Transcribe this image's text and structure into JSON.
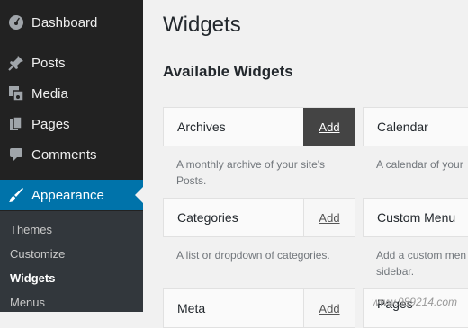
{
  "sidebar": {
    "items": [
      {
        "label": "Dashboard",
        "icon": "dashboard-icon"
      },
      {
        "label": "Posts",
        "icon": "pin-icon"
      },
      {
        "label": "Media",
        "icon": "media-icon"
      },
      {
        "label": "Pages",
        "icon": "pages-icon"
      },
      {
        "label": "Comments",
        "icon": "comment-icon"
      },
      {
        "label": "Appearance",
        "icon": "paintbrush-icon",
        "active": true
      }
    ],
    "submenu": [
      "Themes",
      "Customize",
      "Widgets",
      "Menus"
    ],
    "submenu_current": "Widgets"
  },
  "main": {
    "title": "Widgets",
    "section_title": "Available Widgets",
    "widgets": [
      {
        "name": "Archives",
        "add_label": "Add",
        "description": "A monthly archive of your site's Posts."
      },
      {
        "name": "Calendar",
        "description": "A calendar of your"
      },
      {
        "name": "Categories",
        "add_label": "Add",
        "description": "A list or dropdown of categories."
      },
      {
        "name": "Custom Menu",
        "description": "Add a custom men sidebar."
      },
      {
        "name": "Meta",
        "add_label": "Add"
      },
      {
        "name": "Pages"
      }
    ]
  },
  "watermark": "www.989214.com",
  "colors": {
    "sidebar_bg": "#222222",
    "active_bg": "#0073aa",
    "page_bg": "#f1f1f1"
  }
}
